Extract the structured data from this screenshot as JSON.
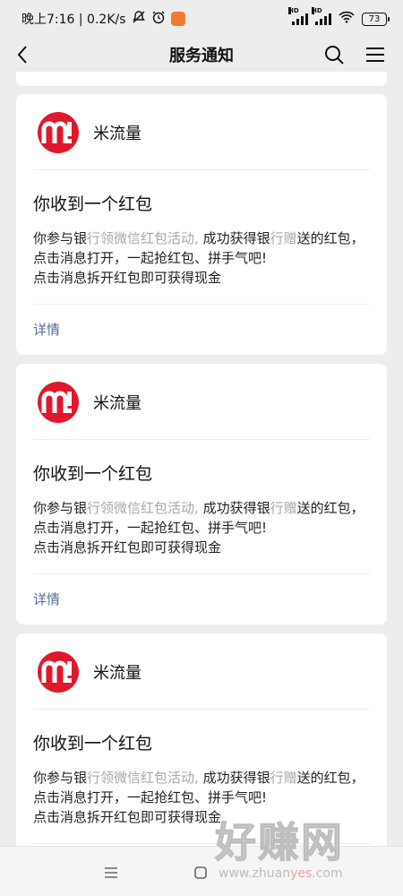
{
  "status_bar": {
    "time_speed": "晚上7:16 | 0.2K/s",
    "hd1": "HD",
    "hd2": "HD",
    "battery": "73"
  },
  "nav": {
    "title": "服务通知"
  },
  "cards": [
    {
      "source": "米流量",
      "title": "你收到一个红包",
      "body_1": "你参与银",
      "body_2": "行领微信红包活动,",
      "body_3": " 成功获得银",
      "body_4": "行赠",
      "body_5": "送的红包，点击消息打开，一起抢红包、拼手气吧!",
      "body_line2": "点击消息拆开红包即可获得现金",
      "detail": "详情"
    },
    {
      "source": "米流量",
      "title": "你收到一个红包",
      "body_1": "你参与银",
      "body_2": "行领微信红包活动,",
      "body_3": " 成功获得银",
      "body_4": "行赠",
      "body_5": "送的红包，点击消息打开，一起抢红包、拼手气吧!",
      "body_line2": "点击消息拆开红包即可获得现金",
      "detail": "详情"
    },
    {
      "source": "米流量",
      "title": "你收到一个红包",
      "body_1": "你参与银",
      "body_2": "行领微信红包活动,",
      "body_3": " 成功获得银",
      "body_4": "行赠",
      "body_5": "送的红包，点击消息打开，一起抢红包、拼手气吧!",
      "body_line2": "点击消息拆开红包即可获得现金",
      "detail": "详情"
    }
  ],
  "watermark": {
    "big": "好赚网",
    "small_1": "www.zhuan",
    "small_2": "yes",
    "small_3": ".com"
  },
  "colors": {
    "logo_red": "#e0182c",
    "link_blue": "#576b95",
    "muted_gray": "#a8a8a8"
  }
}
